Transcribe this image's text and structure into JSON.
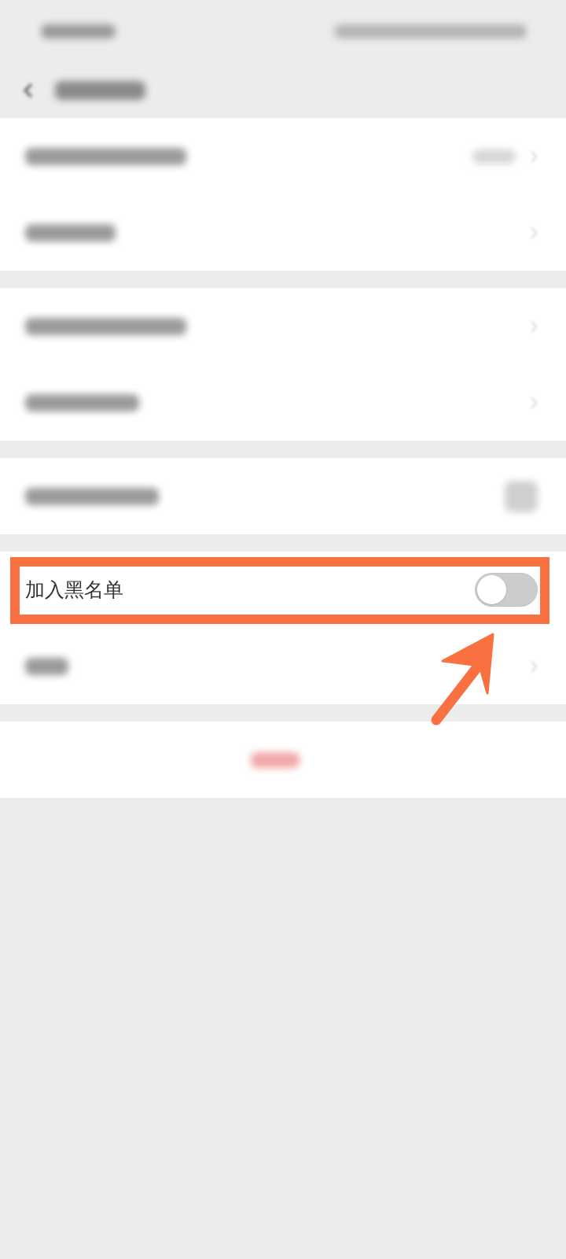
{
  "status_bar": {
    "blurred": true
  },
  "header": {
    "back_button": true,
    "title_blurred": true
  },
  "sections": [
    {
      "rows": [
        {
          "kind": "blurred",
          "blurred_value": true,
          "chevron": true
        },
        {
          "kind": "blurred",
          "chevron": true
        }
      ]
    },
    {
      "rows": [
        {
          "kind": "blurred",
          "chevron": true
        },
        {
          "kind": "blurred",
          "chevron": true
        }
      ]
    },
    {
      "rows": [
        {
          "kind": "blurred",
          "blurred_switch": true
        }
      ]
    },
    {
      "rows": [
        {
          "kind": "switch",
          "label": "加入黑名单",
          "on": false,
          "highlighted": true
        },
        {
          "kind": "blurred",
          "chevron": true
        }
      ]
    },
    {
      "rows": [
        {
          "kind": "blurred-action"
        }
      ]
    }
  ],
  "pointer_arrow": true
}
